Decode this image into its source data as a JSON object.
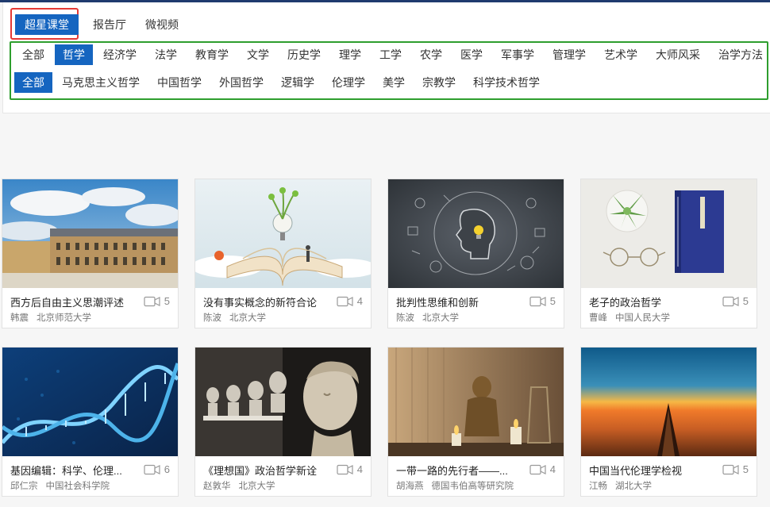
{
  "source_tabs": [
    {
      "label": "超星课堂",
      "active": true
    },
    {
      "label": "报告厅",
      "active": false
    },
    {
      "label": "微视频",
      "active": false
    }
  ],
  "categories": [
    {
      "label": "全部",
      "active": false
    },
    {
      "label": "哲学",
      "active": true
    },
    {
      "label": "经济学",
      "active": false
    },
    {
      "label": "法学",
      "active": false
    },
    {
      "label": "教育学",
      "active": false
    },
    {
      "label": "文学",
      "active": false
    },
    {
      "label": "历史学",
      "active": false
    },
    {
      "label": "理学",
      "active": false
    },
    {
      "label": "工学",
      "active": false
    },
    {
      "label": "农学",
      "active": false
    },
    {
      "label": "医学",
      "active": false
    },
    {
      "label": "军事学",
      "active": false
    },
    {
      "label": "管理学",
      "active": false
    },
    {
      "label": "艺术学",
      "active": false
    },
    {
      "label": "大师风采",
      "active": false
    },
    {
      "label": "治学方法",
      "active": false
    }
  ],
  "subcategories": [
    {
      "label": "全部",
      "active": true
    },
    {
      "label": "马克思主义哲学",
      "active": false
    },
    {
      "label": "中国哲学",
      "active": false
    },
    {
      "label": "外国哲学",
      "active": false
    },
    {
      "label": "逻辑学",
      "active": false
    },
    {
      "label": "伦理学",
      "active": false
    },
    {
      "label": "美学",
      "active": false
    },
    {
      "label": "宗教学",
      "active": false
    },
    {
      "label": "科学技术哲学",
      "active": false
    }
  ],
  "courses": [
    {
      "title": "西方后自由主义思潮评述",
      "count": "5",
      "teacher": "韩震",
      "school": "北京师范大学",
      "image": "palace"
    },
    {
      "title": "没有事实概念的新符合论",
      "count": "4",
      "teacher": "陈波",
      "school": "北京大学",
      "image": "book"
    },
    {
      "title": "批判性思维和创新",
      "count": "5",
      "teacher": "陈波",
      "school": "北京大学",
      "image": "brain"
    },
    {
      "title": "老子的政治哲学",
      "count": "5",
      "teacher": "曹峰",
      "school": "中国人民大学",
      "image": "plant"
    },
    {
      "title": "基因编辑：科学、伦理...",
      "count": "6",
      "teacher": "邱仁宗",
      "school": "中国社会科学院",
      "image": "dna"
    },
    {
      "title": "《理想国》政治哲学新诠",
      "count": "4",
      "teacher": "赵敦华",
      "school": "北京大学",
      "image": "busts"
    },
    {
      "title": "一带一路的先行者——...",
      "count": "4",
      "teacher": "胡海燕",
      "school": "德国韦伯高等研究院",
      "image": "buddha"
    },
    {
      "title": "中国当代伦理学检视",
      "count": "5",
      "teacher": "江畅",
      "school": "湖北大学",
      "image": "boat"
    }
  ],
  "colors": {
    "accent": "#1565c0",
    "highlight_red": "#e53935",
    "highlight_green": "#2e9e2e"
  }
}
